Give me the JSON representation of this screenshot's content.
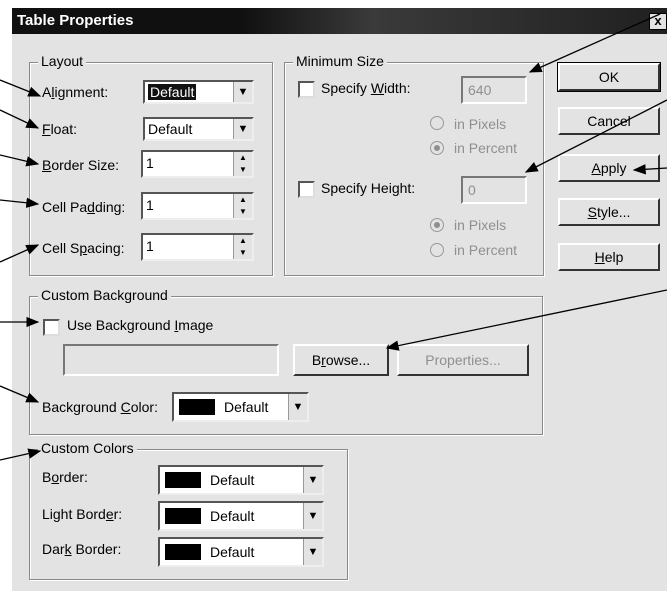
{
  "window": {
    "title": "Table Properties",
    "close_glyph": "x"
  },
  "layout": {
    "legend": "Layout",
    "alignment": {
      "label": "Alignment:",
      "value": "Default"
    },
    "float": {
      "label": "Float:",
      "value": "Default"
    },
    "border_size": {
      "label": "Border Size:",
      "value": "1"
    },
    "cell_padding": {
      "label": "Cell Padding:",
      "value": "1"
    },
    "cell_spacing": {
      "label": "Cell Spacing:",
      "value": "1"
    }
  },
  "min_size": {
    "legend": "Minimum Size",
    "specify_width": {
      "label": "Specify Width:",
      "value": "640",
      "checked": false
    },
    "width_pixels": "in Pixels",
    "width_percent": "in Percent",
    "specify_height": {
      "label": "Specify Height:",
      "value": "0",
      "checked": false
    },
    "height_pixels": "in Pixels",
    "height_percent": "in Percent"
  },
  "buttons": {
    "ok": "OK",
    "cancel": "Cancel",
    "apply": "Apply",
    "style": "Style...",
    "help": "Help"
  },
  "custom_background": {
    "legend": "Custom Background",
    "use_image": {
      "label": "Use Background Image",
      "checked": false
    },
    "image_path": "",
    "browse": "Browse...",
    "properties": "Properties...",
    "bg_color": {
      "label": "Background Color:",
      "value": "Default",
      "swatch": "#000000"
    }
  },
  "custom_colors": {
    "legend": "Custom Colors",
    "border": {
      "label": "Border:",
      "value": "Default",
      "swatch": "#000000"
    },
    "light_border": {
      "label": "Light Border:",
      "value": "Default",
      "swatch": "#000000"
    },
    "dark_border": {
      "label": "Dark Border:",
      "value": "Default",
      "swatch": "#000000"
    }
  }
}
